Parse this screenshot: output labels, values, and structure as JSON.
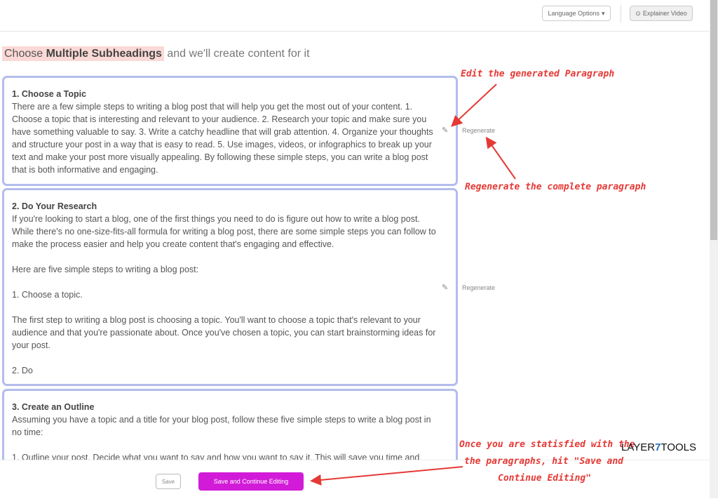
{
  "topbar": {
    "language_label": "Language Options",
    "language_caret": "▾",
    "video_icon": "play-circle-icon",
    "video_glyph": "⊙",
    "video_label": "Explainer Video"
  },
  "heading": {
    "highlight_prefix": "Choose ",
    "highlight_bold": "Multiple Subheadings",
    "rest": " and we'll create content for it"
  },
  "cards": [
    {
      "title": "1. Choose a Topic",
      "body": "There are a few simple steps to writing a blog post that will help you get the most out of your content. 1. Choose a topic that is interesting and relevant to your audience. 2. Research your topic and make sure you have something valuable to say. 3. Write a catchy headline that will grab attention. 4. Organize your thoughts and structure your post in a way that is easy to read. 5. Use images, videos, or infographics to break up your text and make your post more visually appealing. By following these simple steps, you can write a blog post that is both informative and engaging.",
      "regenerate_label": "Regenerate"
    },
    {
      "title": "2. Do Your Research",
      "body": "If you're looking to start a blog, one of the first things you need to do is figure out how to write a blog post. While there's no one-size-fits-all formula for writing a blog post, there are some simple steps you can follow to make the process easier and help you create content that's engaging and effective.\n\nHere are five simple steps to writing a blog post:\n\n1. Choose a topic.\n\nThe first step to writing a blog post is choosing a topic. You'll want to choose a topic that's relevant to your audience and that you're passionate about. Once you've chosen a topic, you can start brainstorming ideas for your post.\n\n2. Do",
      "regenerate_label": "Regenerate"
    },
    {
      "title": "3. Create an Outline",
      "body": "Assuming you have a topic and a title for your blog post, follow these five simple steps to write a blog post in no time:\n\n1. Outline your post. Decide what you want to say and how you want to say it. This will save you time and"
    }
  ],
  "icons": {
    "edit": "pencil-icon",
    "edit_glyph": "✎"
  },
  "bottom": {
    "save_label": "Save",
    "continue_label": "Save and Continue Editing"
  },
  "annotations": {
    "edit": "Edit the generated Paragraph",
    "regenerate": "Regenerate the complete paragraph",
    "save_line1": "Once you are statisfied with the",
    "save_line2": "the paragraphs, hit \"Save and",
    "save_line3": "Continue Editing\""
  },
  "brand": {
    "part1": "LAYER",
    "part2": "7",
    "part3": "TOOLS"
  },
  "colors": {
    "card_border": "#b3bcec",
    "heading_highlight": "#fbd9d6",
    "primary_button": "#d21bd8",
    "annotation": "#e53935",
    "brand_accent": "#1f6fbf"
  }
}
